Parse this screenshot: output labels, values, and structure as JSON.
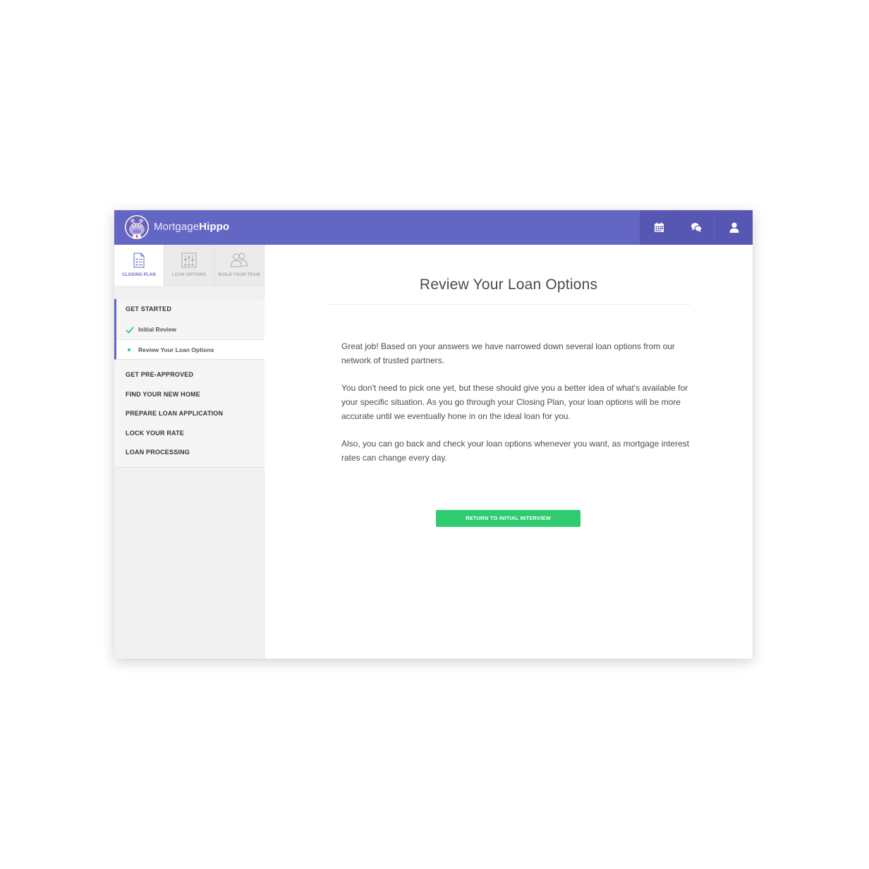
{
  "brand": {
    "name_light": "Mortgage",
    "name_bold": "Hippo"
  },
  "header": {
    "icons": [
      "calendar-icon",
      "chat-icon",
      "user-icon"
    ],
    "color": "#6466c4"
  },
  "sidebar": {
    "tabs": [
      {
        "label": "CLOSING PLAN",
        "icon": "document-checklist-icon",
        "active": true
      },
      {
        "label": "LOAN OPTIONS",
        "icon": "sliders-icon",
        "active": false
      },
      {
        "label": "BUILD YOUR TEAM",
        "icon": "people-icon",
        "active": false
      }
    ],
    "group": {
      "title": "GET STARTED",
      "items": [
        {
          "label": "Initial Review",
          "status": "complete"
        },
        {
          "label": "Review Your Loan Options",
          "status": "current"
        }
      ]
    },
    "steps": [
      "GET PRE-APPROVED",
      "FIND YOUR NEW HOME",
      "PREPARE LOAN APPLICATION",
      "LOCK YOUR RATE",
      "LOAN PROCESSING"
    ]
  },
  "main": {
    "title": "Review Your Loan Options",
    "paragraphs": [
      "Great job! Based on your answers we have narrowed down several loan options from our network of trusted partners.",
      "You don't need to pick one yet, but these should give you a better idea of what's available for your specific situation. As you go through your Closing Plan, your loan options will be more accurate until we eventually hone in on the ideal loan for you.",
      "Also, you can go back and check your loan options whenever you want, as mortgage interest rates can change every day."
    ],
    "cta_label": "RETURN TO INITIAL INTERVIEW"
  },
  "colors": {
    "accent": "#6466c4",
    "success": "#2ecc6f"
  }
}
